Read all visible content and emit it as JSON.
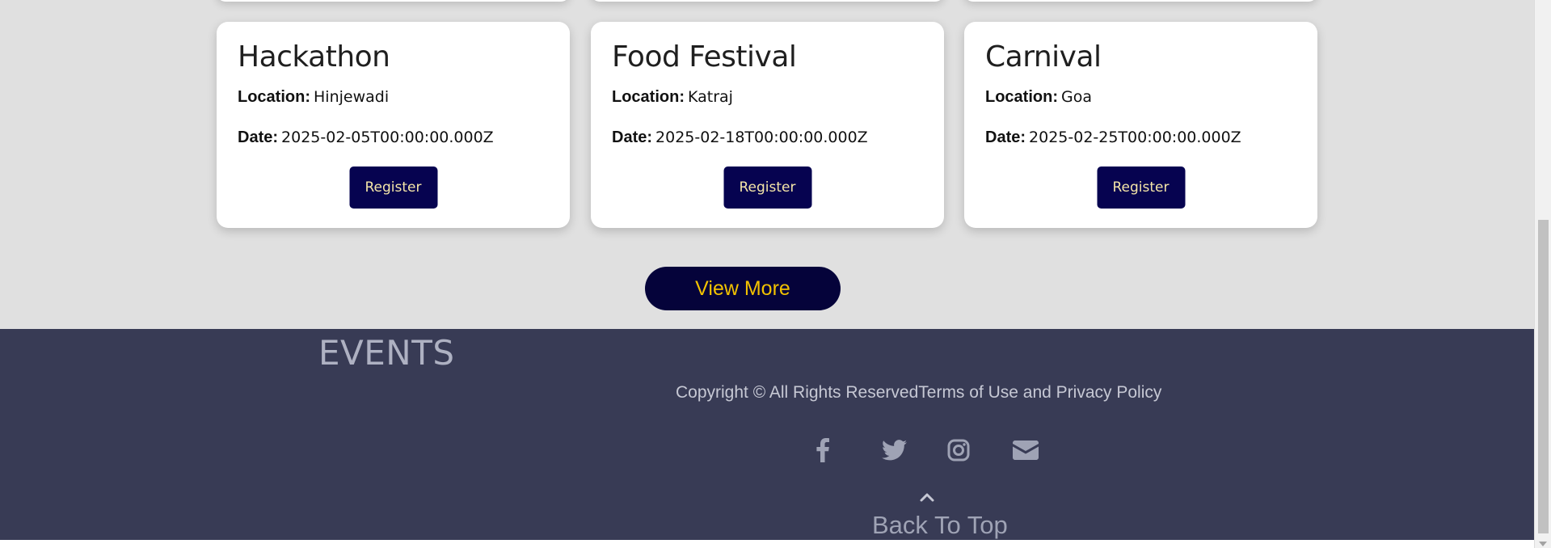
{
  "events": [
    {
      "title": "Hackathon",
      "location_label": "Location:",
      "location": "Hinjewadi",
      "date_label": "Date:",
      "date": "2025-02-05T00:00:00.000Z",
      "register_label": "Register"
    },
    {
      "title": "Food Festival",
      "location_label": "Location:",
      "location": "Katraj",
      "date_label": "Date:",
      "date": "2025-02-18T00:00:00.000Z",
      "register_label": "Register"
    },
    {
      "title": "Carnival",
      "location_label": "Location:",
      "location": "Goa",
      "date_label": "Date:",
      "date": "2025-02-25T00:00:00.000Z",
      "register_label": "Register"
    }
  ],
  "view_more_label": "View More",
  "footer": {
    "brand": "EVENTS",
    "copyright": "Copyright © All Rights ReservedTerms of Use and Privacy Policy",
    "socials": [
      "facebook-icon",
      "twitter-icon",
      "instagram-icon",
      "envelope-icon"
    ],
    "back_to_top": "Back To Top"
  },
  "colors": {
    "section_bg": "#e0e0e0",
    "footer_bg": "#383b55",
    "button_bg": "#060350",
    "button_text": "#f5e6a8",
    "view_more_text": "#f2c200"
  }
}
